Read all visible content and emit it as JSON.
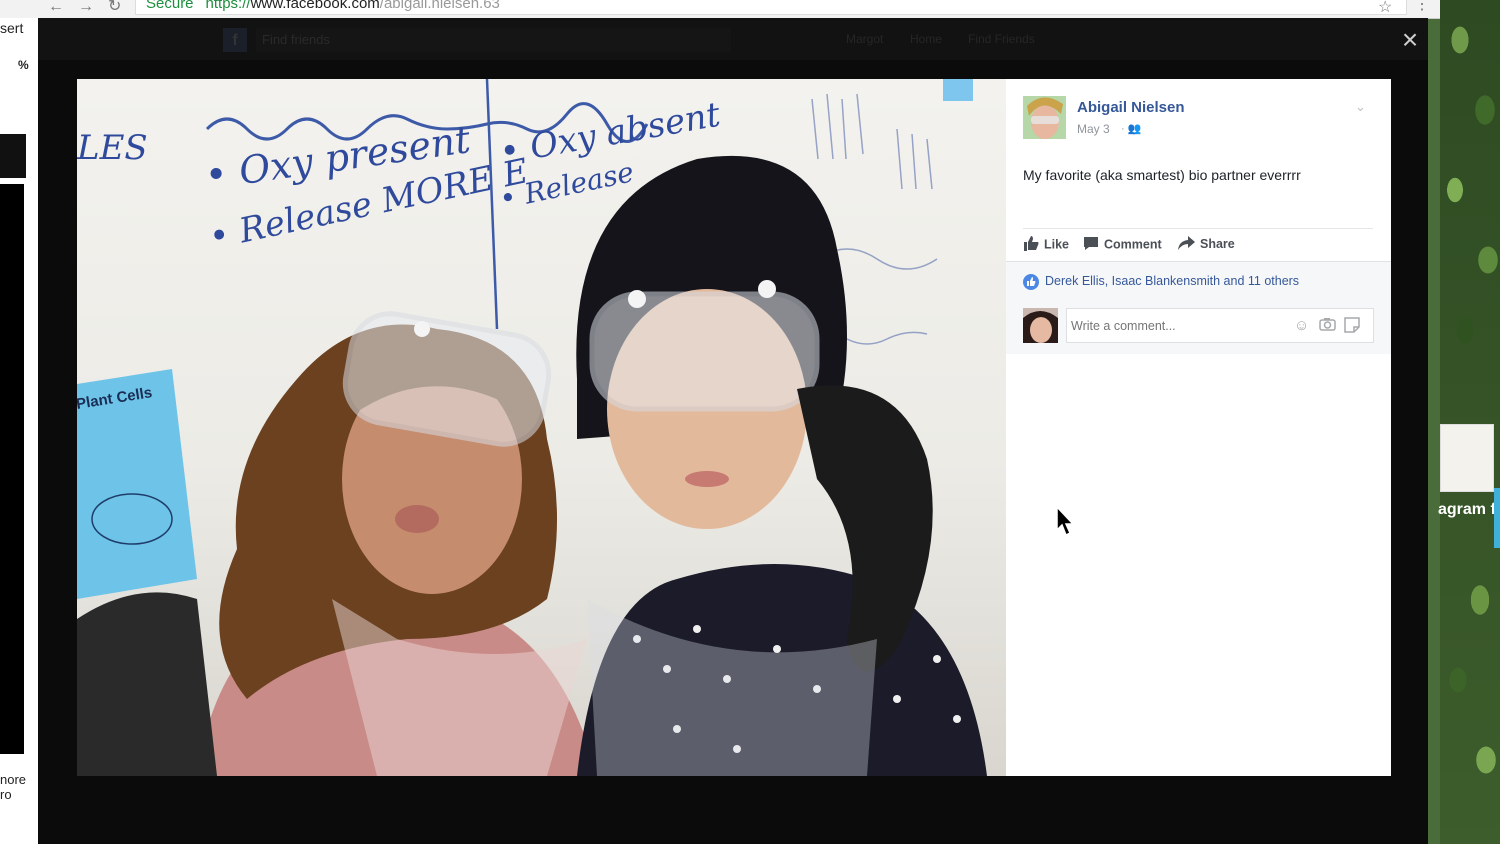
{
  "browser": {
    "security_label": "Secure",
    "url_scheme": "https://",
    "url_host": "www.facebook.com",
    "url_path": "/abigail.nielsen.63"
  },
  "left_app": {
    "text_top": "sert",
    "text_percent": "%",
    "text_bottom": "nore ro"
  },
  "fb_top": {
    "logo": "f",
    "search_placeholder": "Find friends",
    "nav_name": "Margot",
    "nav_home": "Home",
    "nav_find": "Find Friends"
  },
  "photo": {
    "whiteboard_text_1": "• Oxy present",
    "whiteboard_text_2": "• Release MORE E",
    "whiteboard_text_3": "• Oxy absent",
    "whiteboard_text_4": "• Release",
    "whiteboard_text_5": "LES",
    "poster_title": "Plant Cells"
  },
  "post": {
    "author": "Abigail Nielsen",
    "date": "May 3",
    "caption": "My favorite (aka smartest) bio partner everrrr"
  },
  "actions": {
    "like": "Like",
    "comment": "Comment",
    "share": "Share"
  },
  "likes": {
    "text": "Derek Ellis, Isaac Blankensmith and 11 others"
  },
  "comment_box": {
    "placeholder": "Write a comment..."
  },
  "right_peek": {
    "text": "agram f"
  },
  "colors": {
    "link_blue": "#365899",
    "like_blue": "#4b88e6",
    "overlay": "#0b0b0b"
  },
  "icons": {
    "close": "close-icon",
    "like": "thumbs-up-icon",
    "comment": "comment-bubble-icon",
    "share": "share-arrow-icon",
    "audience": "friends-icon",
    "chevron": "chevron-down-icon",
    "emoji": "emoji-icon",
    "camera": "camera-icon",
    "sticker": "sticker-icon"
  }
}
